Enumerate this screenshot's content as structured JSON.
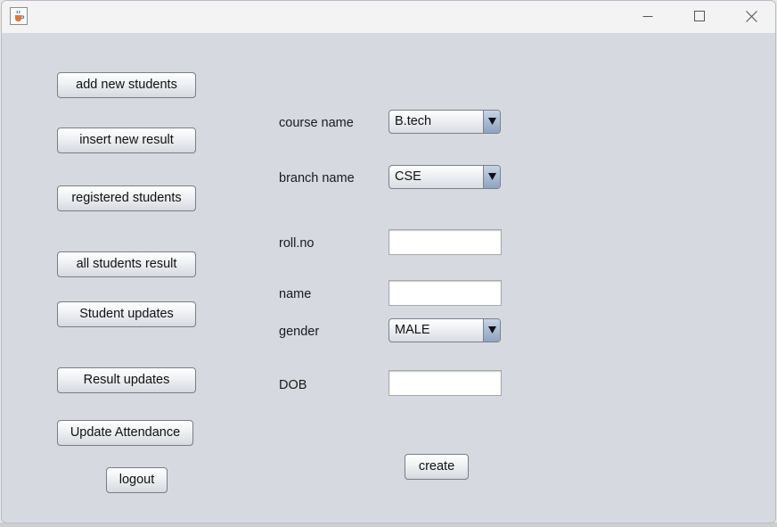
{
  "window": {
    "title": "",
    "controls": {
      "minimize": "minimize-icon",
      "maximize": "maximize-icon",
      "close": "close-icon"
    }
  },
  "sidebar": {
    "add_new_students": "add new students",
    "insert_new_result": "insert new result",
    "registered_students": "registered students",
    "all_students_result": "all students result",
    "student_updates": "Student updates",
    "result_updates": "Result updates",
    "update_attendance": "Update Attendance",
    "logout": "logout"
  },
  "form": {
    "course_label": "course name",
    "course_value": "B.tech",
    "branch_label": "branch name",
    "branch_value": "CSE",
    "rollno_label": "roll.no",
    "rollno_value": "",
    "name_label": "name",
    "name_value": "",
    "gender_label": "gender",
    "gender_value": "MALE",
    "dob_label": "DOB",
    "dob_value": "",
    "create_label": "create"
  },
  "colors": {
    "window_bg": "#d6d9e0",
    "titlebar_bg": "#f3f3f3",
    "combo_arrow": "#a9bbd3"
  }
}
